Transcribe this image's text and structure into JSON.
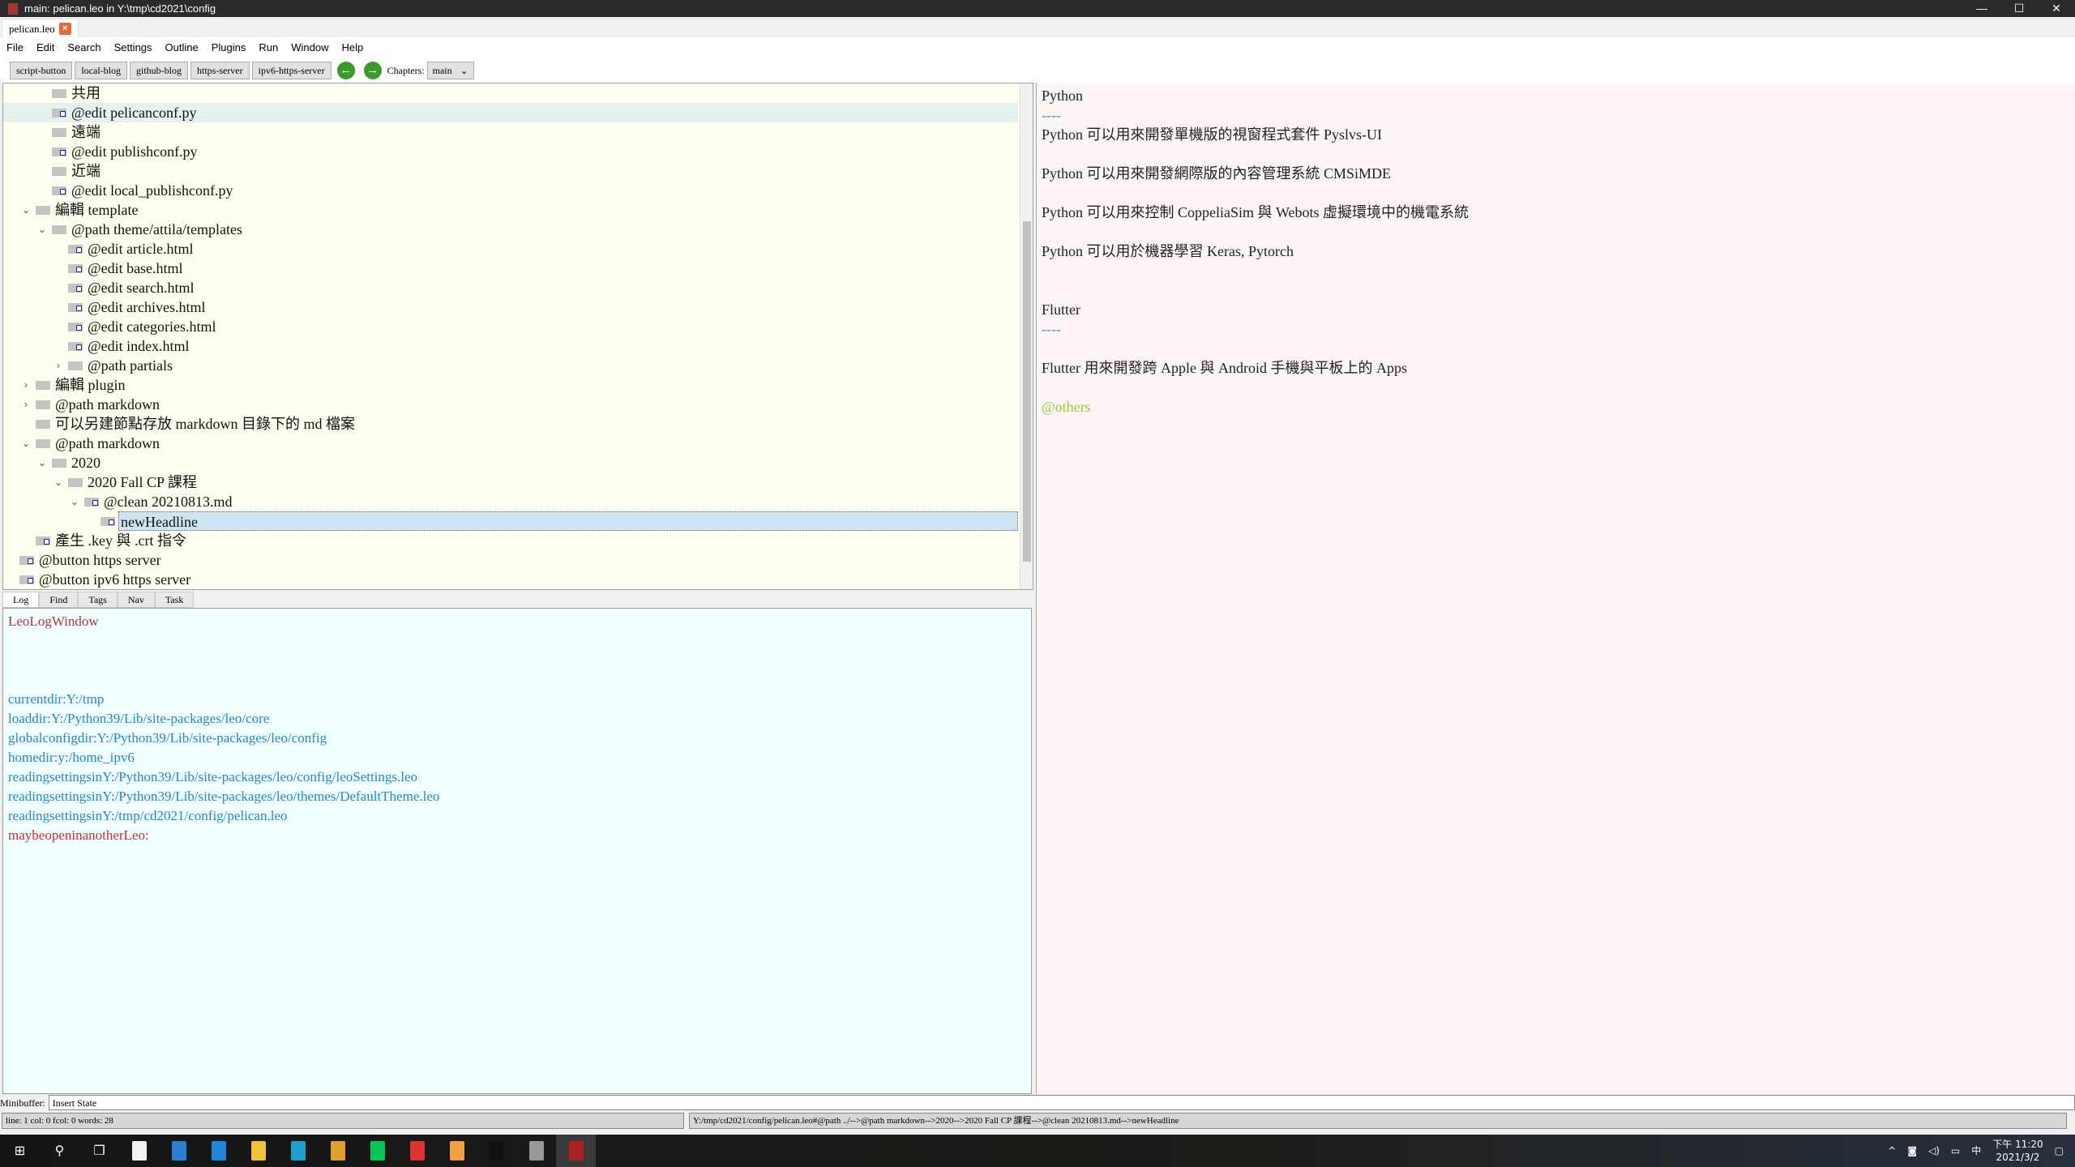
{
  "window": {
    "title": "main: pelican.leo in Y:\\tmp\\cd2021\\config",
    "tab": "pelican.leo"
  },
  "menu": [
    "File",
    "Edit",
    "Search",
    "Settings",
    "Outline",
    "Plugins",
    "Run",
    "Window",
    "Help"
  ],
  "toolbar": {
    "buttons": [
      "script-button",
      "local-blog",
      "github-blog",
      "https-server",
      "ipv6-https-server"
    ],
    "chapters_label": "Chapters:",
    "chapter": "main"
  },
  "tree": [
    {
      "label": "共用",
      "depth": 2,
      "body": false,
      "chev": ""
    },
    {
      "label": "@edit pelicanconf.py",
      "depth": 2,
      "body": true,
      "chev": "",
      "hover": true
    },
    {
      "label": "遠端",
      "depth": 2,
      "body": false,
      "chev": ""
    },
    {
      "label": "@edit publishconf.py",
      "depth": 2,
      "body": true,
      "chev": ""
    },
    {
      "label": "近端",
      "depth": 2,
      "body": false,
      "chev": ""
    },
    {
      "label": "@edit local_publishconf.py",
      "depth": 2,
      "body": true,
      "chev": ""
    },
    {
      "label": "編輯 template",
      "depth": 1,
      "body": false,
      "chev": "open"
    },
    {
      "label": "@path theme/attila/templates",
      "depth": 2,
      "body": false,
      "chev": "open"
    },
    {
      "label": "@edit article.html",
      "depth": 3,
      "body": true,
      "chev": ""
    },
    {
      "label": "@edit base.html",
      "depth": 3,
      "body": true,
      "chev": ""
    },
    {
      "label": "@edit search.html",
      "depth": 3,
      "body": true,
      "chev": ""
    },
    {
      "label": "@edit archives.html",
      "depth": 3,
      "body": true,
      "chev": ""
    },
    {
      "label": "@edit categories.html",
      "depth": 3,
      "body": true,
      "chev": ""
    },
    {
      "label": "@edit index.html",
      "depth": 3,
      "body": true,
      "chev": ""
    },
    {
      "label": "@path partials",
      "depth": 3,
      "body": false,
      "chev": "closed"
    },
    {
      "label": "編輯 plugin",
      "depth": 1,
      "body": false,
      "chev": "closed"
    },
    {
      "label": "@path markdown",
      "depth": 1,
      "body": false,
      "chev": "closed"
    },
    {
      "label": "可以另建節點存放 markdown 目錄下的 md 檔案",
      "depth": 1,
      "body": false,
      "chev": ""
    },
    {
      "label": "@path markdown",
      "depth": 1,
      "body": false,
      "chev": "open"
    },
    {
      "label": "2020",
      "depth": 2,
      "body": false,
      "chev": "open"
    },
    {
      "label": "2020 Fall CP 課程",
      "depth": 3,
      "body": false,
      "chev": "open"
    },
    {
      "label": "@clean 20210813.md",
      "depth": 4,
      "body": true,
      "chev": "open"
    },
    {
      "label": "newHeadline",
      "depth": 5,
      "body": true,
      "chev": "",
      "selected": true
    },
    {
      "label": "產生 .key 與 .crt 指令",
      "depth": 1,
      "body": true,
      "chev": ""
    },
    {
      "label": "@button https server",
      "depth": 0,
      "body": true,
      "chev": ""
    },
    {
      "label": "@button ipv6 https server",
      "depth": 0,
      "body": true,
      "chev": ""
    }
  ],
  "log_tabs": [
    "Log",
    "Find",
    "Tags",
    "Nav",
    "Task"
  ],
  "log": [
    {
      "text": "LeoLogWindow",
      "cls": "red"
    },
    {
      "text": "",
      "cls": "faint"
    },
    {
      "text": "",
      "cls": "faint"
    },
    {
      "text": "",
      "cls": "faint"
    },
    {
      "text": "currentdir:Y:/tmp",
      "cls": "blue"
    },
    {
      "text": "loaddir:Y:/Python39/Lib/site-packages/leo/core",
      "cls": "blue"
    },
    {
      "text": "globalconfigdir:Y:/Python39/Lib/site-packages/leo/config",
      "cls": "blue"
    },
    {
      "text": "homedir:y:/home_ipv6",
      "cls": "blue"
    },
    {
      "text": "readingsettingsinY:/Python39/Lib/site-packages/leo/config/leoSettings.leo",
      "cls": "blue"
    },
    {
      "text": "readingsettingsinY:/Python39/Lib/site-packages/leo/themes/DefaultTheme.leo",
      "cls": "blue"
    },
    {
      "text": "readingsettingsinY:/tmp/cd2021/config/pelican.leo",
      "cls": "blue"
    },
    {
      "text": "maybeopeninanotherLeo:",
      "cls": "red"
    }
  ],
  "body": [
    {
      "text": "Python",
      "cls": ""
    },
    {
      "text": "----",
      "cls": "dash"
    },
    {
      "text": "Python 可以用來開發單機版的視窗程式套件 Pyslvs-UI",
      "cls": ""
    },
    {
      "text": "",
      "cls": ""
    },
    {
      "text": "Python 可以用來開發網際版的內容管理系統 CMSiMDE",
      "cls": ""
    },
    {
      "text": "",
      "cls": ""
    },
    {
      "text": "Python 可以用來控制 CoppeliaSim 與 Webots 虛擬環境中的機電系統",
      "cls": ""
    },
    {
      "text": "",
      "cls": ""
    },
    {
      "text": "Python 可以用於機器學習 Keras, Pytorch",
      "cls": ""
    },
    {
      "text": "",
      "cls": ""
    },
    {
      "text": "",
      "cls": ""
    },
    {
      "text": "Flutter",
      "cls": ""
    },
    {
      "text": "----",
      "cls": "dash"
    },
    {
      "text": "",
      "cls": ""
    },
    {
      "text": "Flutter 用來開發跨 Apple 與 Android 手機與平板上的 Apps",
      "cls": ""
    },
    {
      "text": "",
      "cls": ""
    },
    {
      "text": "@others",
      "cls": "others"
    }
  ],
  "minibuffer": {
    "label": "Minibuffer:",
    "value": "Insert State"
  },
  "status": {
    "left": "line: 1 col: 0  fcol: 0 words: 28",
    "right": "Y:/tmp/cd2021/config/pelican.leo#@path ../-->@path markdown-->2020-->2020 Fall CP 課程-->@clean 20210813.md-->newHeadline"
  },
  "taskbar": {
    "apps": [
      {
        "name": "store",
        "color": "#f2f2f2"
      },
      {
        "name": "azure",
        "color": "#2a7fd4"
      },
      {
        "name": "mail",
        "color": "#1e88d8"
      },
      {
        "name": "file-explorer",
        "color": "#f3c23c"
      },
      {
        "name": "edge",
        "color": "#1fa0c8"
      },
      {
        "name": "chrome",
        "color": "#e0a030"
      },
      {
        "name": "line",
        "color": "#06c755"
      },
      {
        "name": "acrobat",
        "color": "#d33"
      },
      {
        "name": "inkscape-like",
        "color": "#f0a040"
      },
      {
        "name": "terminal",
        "color": "#111"
      },
      {
        "name": "sphere",
        "color": "#999"
      },
      {
        "name": "leo",
        "color": "#a22"
      }
    ],
    "time": "下午 11:20",
    "date": "2021/3/2",
    "ime": "中"
  }
}
